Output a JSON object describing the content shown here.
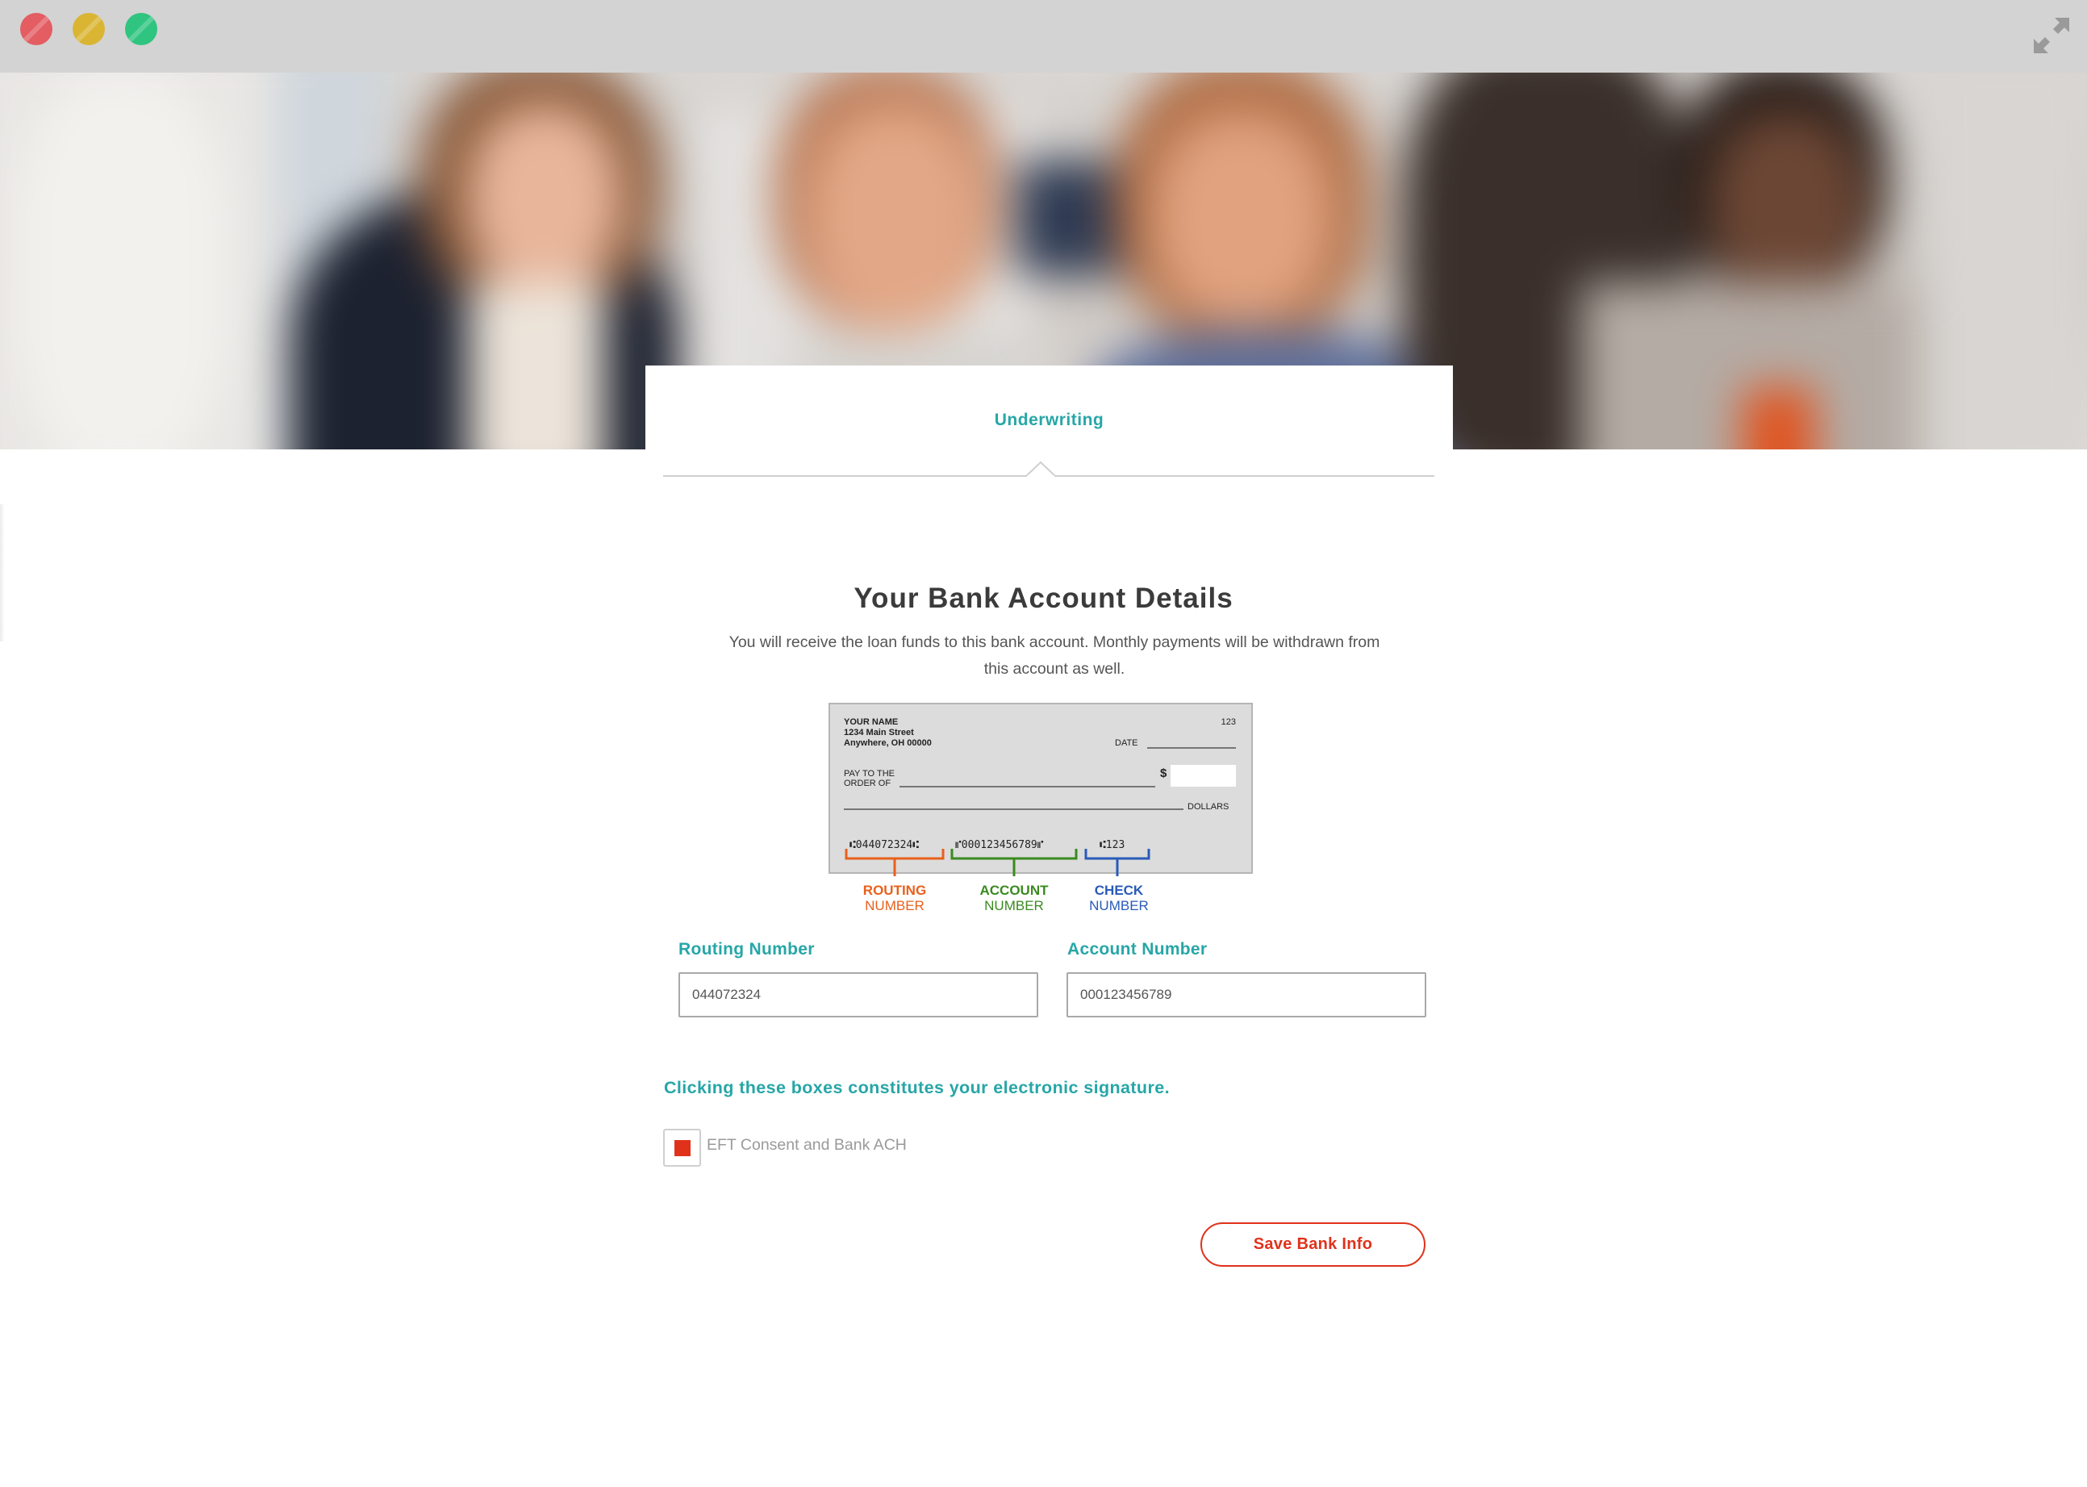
{
  "window": {
    "controls": [
      "close",
      "minimize",
      "zoom"
    ],
    "expand_icon": "expand-arrows-icon"
  },
  "hero": {
    "image": "blurred-group-photo"
  },
  "step": {
    "label": "Underwriting"
  },
  "main": {
    "title": "Your Bank Account Details",
    "description": "You will receive the loan funds to this bank account. Monthly payments will be withdrawn from this account as well."
  },
  "check_illustration": {
    "name": "YOUR NAME",
    "street": "1234 Main Street",
    "city": "Anywhere, OH 00000",
    "check_no": "123",
    "date_label": "DATE",
    "pay_to_1": "PAY TO THE",
    "pay_to_2": "ORDER OF",
    "dollar_sign": "$",
    "dollars": "DOLLARS",
    "micr_routing": "⑆044072324⑆",
    "micr_account": "⑈000123456789⑈",
    "micr_check": "⑆123",
    "routing_1": "ROUTING",
    "routing_2": "NUMBER",
    "account_1": "ACCOUNT",
    "account_2": "NUMBER",
    "check_1": "CHECK",
    "check_2": "NUMBER"
  },
  "form": {
    "routing_label": "Routing Number",
    "routing_value": "044072324",
    "account_label": "Account Number",
    "account_value": "000123456789"
  },
  "signature": {
    "note": "Clicking these boxes constitutes your electronic signature.",
    "checkbox_label": "EFT Consent and Bank ACH"
  },
  "actions": {
    "save_label": "Save Bank Info"
  },
  "colors": {
    "accent": "#27a6a7",
    "action": "#e0321b",
    "routing": "#e8601c",
    "account": "#3a8a1f",
    "check": "#2a5bb8"
  }
}
